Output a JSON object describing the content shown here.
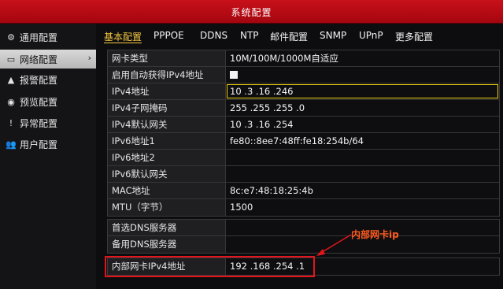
{
  "window": {
    "title": "系统配置"
  },
  "sidebar": {
    "items": [
      {
        "label": "通用配置",
        "icon": "gear-icon"
      },
      {
        "label": "网络配置",
        "icon": "network-icon",
        "active": true
      },
      {
        "label": "报警配置",
        "icon": "alarm-icon"
      },
      {
        "label": "预览配置",
        "icon": "eye-icon"
      },
      {
        "label": "异常配置",
        "icon": "warning-icon"
      },
      {
        "label": "用户配置",
        "icon": "users-icon"
      }
    ]
  },
  "tabs": [
    "基本配置",
    "PPPOE",
    "DDNS",
    "NTP",
    "邮件配置",
    "SNMP",
    "UPnP",
    "更多配置"
  ],
  "form": {
    "rows": [
      {
        "label": "网卡类型",
        "value": "10M/100M/1000M自适应"
      },
      {
        "label": "启用自动获得IPv4地址",
        "value": ""
      },
      {
        "label": "IPv4地址",
        "value": "10  .3   .16  .246"
      },
      {
        "label": "IPv4子网掩码",
        "value": "255 .255 .255 .0"
      },
      {
        "label": "IPv4默认网关",
        "value": "10  .3   .16  .254"
      },
      {
        "label": "IPv6地址1",
        "value": "fe80::8ee7:48ff:fe18:254b/64"
      },
      {
        "label": "IPv6地址2",
        "value": ""
      },
      {
        "label": "IPv6默认网关",
        "value": ""
      },
      {
        "label": "MAC地址",
        "value": "8c:e7:48:18:25:4b"
      },
      {
        "label": "MTU（字节）",
        "value": "1500"
      }
    ],
    "dns": [
      {
        "label": "首选DNS服务器",
        "value": ""
      },
      {
        "label": "备用DNS服务器",
        "value": ""
      }
    ],
    "internal": {
      "label": "内部网卡IPv4地址",
      "value": "192 .168 .254 .1"
    }
  },
  "annotation": {
    "text": "内部网卡ip"
  },
  "colors": {
    "titlebar": "#c0101a",
    "active_tab": "#f4c842",
    "highlight": "#e2141c",
    "annotation": "#ff5a1e"
  }
}
